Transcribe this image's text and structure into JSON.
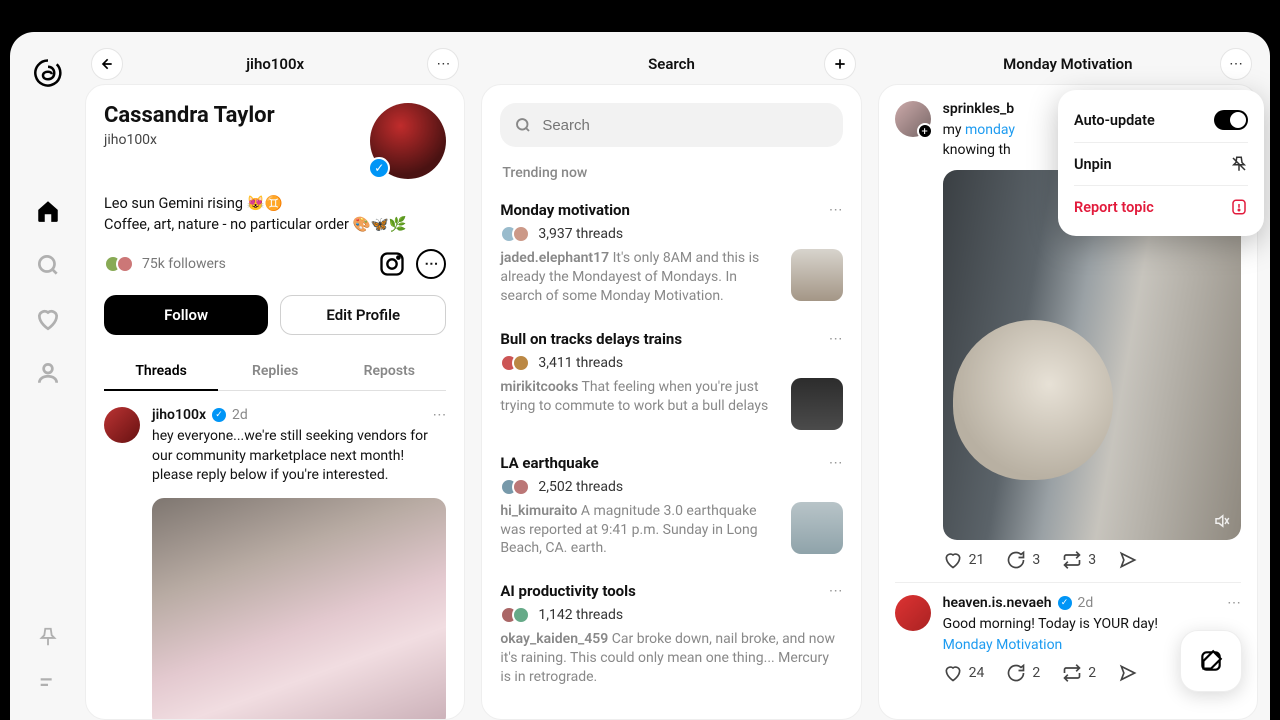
{
  "columns": {
    "profile": {
      "header": "jiho100x"
    },
    "search": {
      "header": "Search"
    },
    "feed": {
      "header": "Monday Motivation"
    }
  },
  "profile": {
    "display_name": "Cassandra Taylor",
    "handle": "jiho100x",
    "bio_line1": "Leo sun Gemini rising 😻♊",
    "bio_line2": "Coffee, art, nature - no particular order 🎨🦋🌿",
    "followers": "75k followers",
    "follow_label": "Follow",
    "edit_label": "Edit Profile",
    "tabs": {
      "threads": "Threads",
      "replies": "Replies",
      "reposts": "Reposts"
    },
    "post": {
      "user": "jiho100x",
      "time": "2d",
      "text": "hey everyone...we're still seeking vendors for our community marketplace next month! please reply below if you're interested."
    }
  },
  "search": {
    "placeholder": "Search",
    "section": "Trending now",
    "items": [
      {
        "title": "Monday motivation",
        "count": "3,937 threads",
        "user": "jaded.elephant17",
        "text": "It's only 8AM and this is already the Mondayest of Mondays. In search of some Monday Motivation."
      },
      {
        "title": "Bull on tracks delays trains",
        "count": "3,411 threads",
        "user": "mirikitcooks",
        "text": "That feeling when you're just trying to commute to work but a bull delays"
      },
      {
        "title": "LA earthquake",
        "count": "2,502 threads",
        "user": "hi_kimuraito",
        "text": "A magnitude 3.0 earthquake was reported at 9:41 p.m. Sunday in Long Beach, CA. earth."
      },
      {
        "title": "AI productivity tools",
        "count": "1,142 threads",
        "user": "okay_kaiden_459",
        "text": "Car broke down, nail broke, and now it's raining. This could only mean one thing... Mercury is in retrograde."
      }
    ]
  },
  "feed": {
    "menu": {
      "auto": "Auto-update",
      "unpin": "Unpin",
      "report": "Report topic"
    },
    "post1": {
      "user": "sprinkles_b",
      "text_prefix": "my ",
      "link": "monday",
      "text_suffix": " knowing th",
      "likes": "21",
      "replies": "3",
      "reposts": "3"
    },
    "post2": {
      "user": "heaven.is.nevaeh",
      "time": "2d",
      "text": "Good morning! Today is YOUR day!",
      "tag": "Monday Motivation",
      "likes": "24",
      "replies": "2",
      "reposts": "2"
    }
  }
}
